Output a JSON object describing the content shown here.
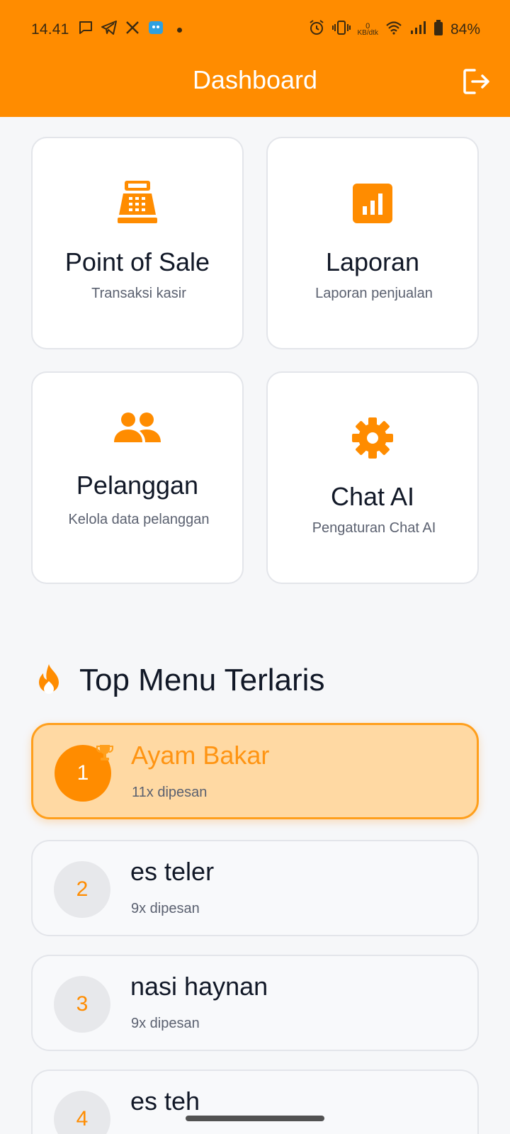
{
  "status_bar": {
    "time": "14.41",
    "net_speed_value": "0",
    "net_speed_unit": "KB/dtk",
    "battery": "84%",
    "left_icons": [
      "message-icon",
      "telegram-icon",
      "x-icon",
      "app-icon",
      "dot"
    ],
    "right_icons": [
      "alarm-icon",
      "vibrate-icon",
      "wifi-icon",
      "signal-icon",
      "battery-icon"
    ]
  },
  "header": {
    "title": "Dashboard",
    "logout_icon": "logout-icon"
  },
  "cards": [
    {
      "title": "Point of Sale",
      "subtitle": "Transaksi kasir",
      "icon": "cash-register-icon"
    },
    {
      "title": "Laporan",
      "subtitle": "Laporan penjualan",
      "icon": "bar-chart-icon"
    },
    {
      "title": "Pelanggan",
      "subtitle": "Kelola data pelanggan",
      "icon": "people-icon"
    },
    {
      "title": "Chat AI",
      "subtitle": "Pengaturan Chat AI",
      "icon": "gear-icon"
    }
  ],
  "top_menu": {
    "title": "Top Menu Terlaris",
    "icon": "fire-icon",
    "items": [
      {
        "rank": "1",
        "name": "Ayam Bakar",
        "count": "11x dipesan",
        "badge_icon": "trophy-icon"
      },
      {
        "rank": "2",
        "name": "es teler",
        "count": "9x dipesan"
      },
      {
        "rank": "3",
        "name": "nasi haynan",
        "count": "9x dipesan"
      },
      {
        "rank": "4",
        "name": "es teh",
        "count": ""
      }
    ]
  },
  "colors": {
    "accent": "#ff8c00",
    "header_text": "#ffffff",
    "highlight_bg": "#ffd9a3"
  }
}
